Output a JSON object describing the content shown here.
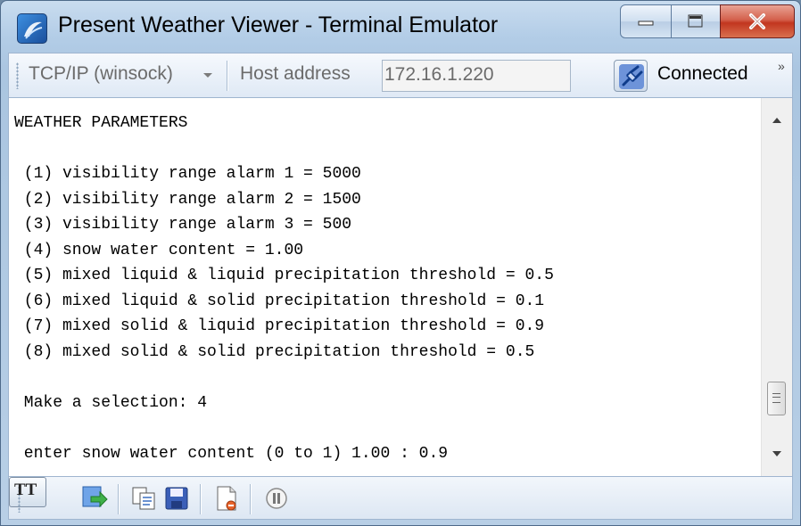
{
  "window": {
    "title": "Present Weather Viewer - Terminal Emulator",
    "icon": "app-logo-icon",
    "controls": [
      "minimize-icon",
      "maximize-icon",
      "close-icon"
    ]
  },
  "toolbar": {
    "protocol": "TCP/IP (winsock)",
    "host_label": "Host address",
    "host_value": "172.16.1.220",
    "status_label": "Connected",
    "overflow": "»"
  },
  "terminal": {
    "lines": [
      "WEATHER PARAMETERS",
      "",
      " (1) visibility range alarm 1 = 5000",
      " (2) visibility range alarm 2 = 1500",
      " (3) visibility range alarm 3 = 500",
      " (4) snow water content = 1.00",
      " (5) mixed liquid & liquid precipitation threshold = 0.5",
      " (6) mixed liquid & solid precipitation threshold = 0.1",
      " (7) mixed solid & liquid precipitation threshold = 0.9",
      " (8) mixed solid & solid precipitation threshold = 0.5",
      "",
      " Make a selection: 4",
      "",
      " enter snow water content (0 to 1) 1.00 : 0.9"
    ]
  },
  "bottombar": {
    "tt_label": "TT",
    "icons": [
      "send-icon",
      "copy-icon",
      "save-icon",
      "log-file-icon",
      "pause-icon"
    ]
  },
  "colors": {
    "titlebar": "#b8d1ea",
    "close_button": "#c9452f",
    "terminal_bg": "#ffffff"
  }
}
